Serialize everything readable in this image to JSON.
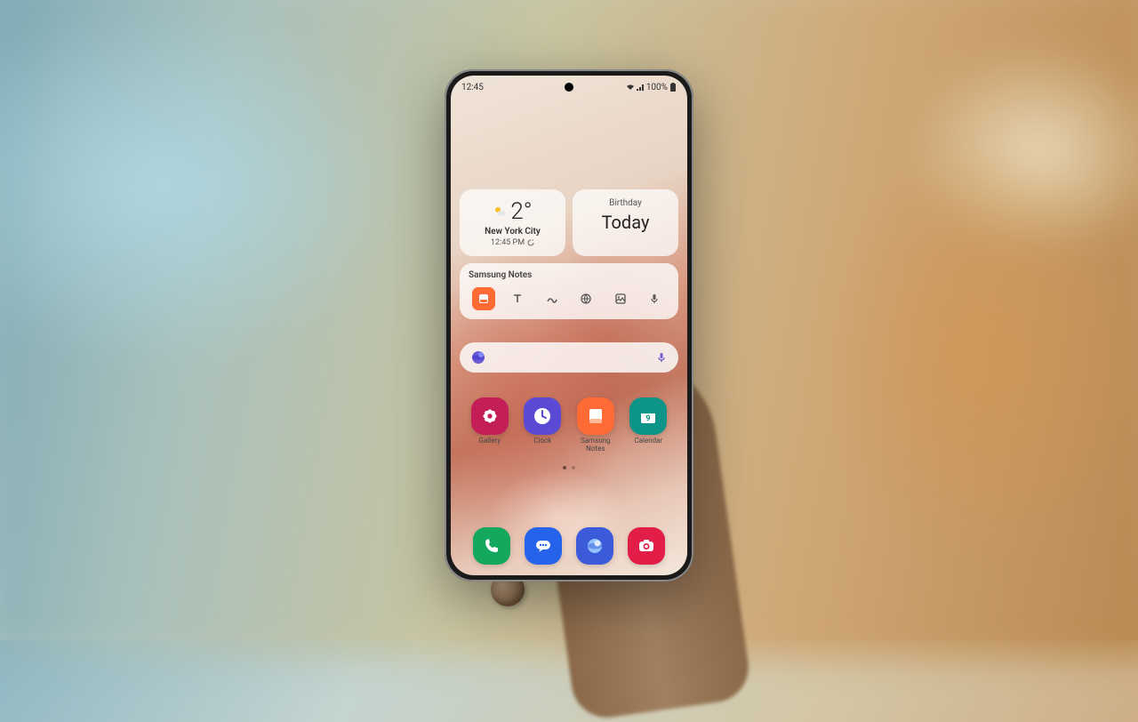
{
  "statusbar": {
    "time": "12:45",
    "battery": "100%"
  },
  "weather": {
    "temp": "2°",
    "city": "New York City",
    "time": "12:45 PM"
  },
  "calendar": {
    "label": "Birthday",
    "day": "Today"
  },
  "notes": {
    "title": "Samsung Notes"
  },
  "search": {
    "placeholder": ""
  },
  "apps": {
    "gallery": "Gallery",
    "clock": "Clock",
    "samsung_notes": "Samsung Notes",
    "calendar": "Calendar",
    "calendar_day": "9"
  },
  "colors": {
    "gallery": "#c41e58",
    "clock": "#5b4bd4",
    "notes": "#ff6b35",
    "calendar": "#0d9488",
    "phone": "#14a85e",
    "messages": "#2563eb",
    "internet": "#3b5bdb",
    "camera": "#e11d48"
  }
}
